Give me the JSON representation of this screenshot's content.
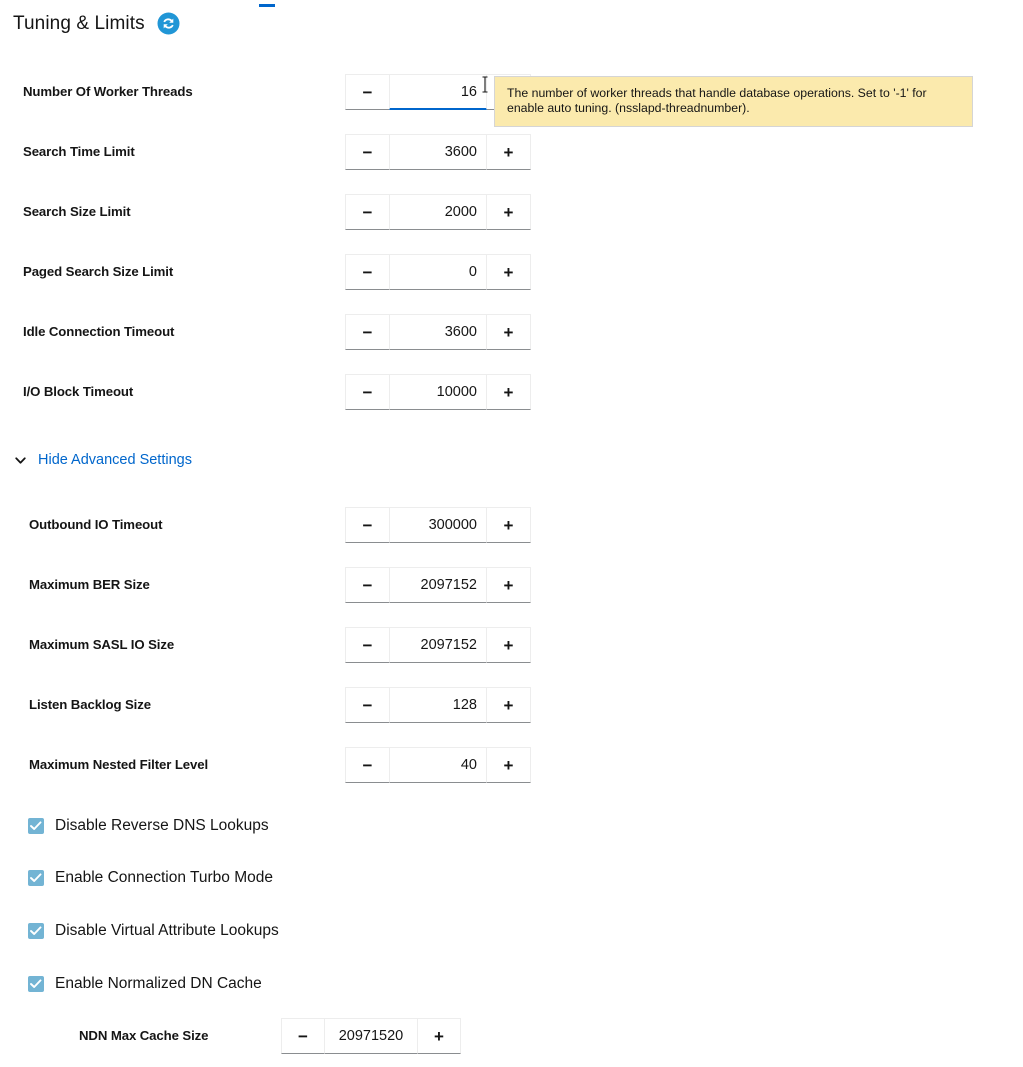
{
  "header": {
    "title": "Tuning & Limits",
    "refresh_icon": "refresh-icon",
    "refresh_color": "#2196d6"
  },
  "colors": {
    "link": "#06c",
    "focus_underline": "#06c",
    "checkbox_fill": "#73b4d4",
    "tooltip_bg": "#fbeaad",
    "tooltip_border": "#d5d5d5"
  },
  "tooltip": {
    "visible": true,
    "text": "The number of worker threads that handle database operations.  Set to '-1' for enable auto tuning. (nsslapd-threadnumber)."
  },
  "basic_fields": [
    {
      "label": "Number Of Worker Threads",
      "value": "16",
      "focused": true,
      "decrement": "−",
      "increment": "+"
    },
    {
      "label": "Search Time Limit",
      "value": "3600",
      "focused": false,
      "decrement": "−",
      "increment": "+"
    },
    {
      "label": "Search Size Limit",
      "value": "2000",
      "focused": false,
      "decrement": "−",
      "increment": "+"
    },
    {
      "label": "Paged Search Size Limit",
      "value": "0",
      "focused": false,
      "decrement": "−",
      "increment": "+"
    },
    {
      "label": "Idle Connection Timeout",
      "value": "3600",
      "focused": false,
      "decrement": "−",
      "increment": "+"
    },
    {
      "label": "I/O Block Timeout",
      "value": "10000",
      "focused": false,
      "decrement": "−",
      "increment": "+"
    }
  ],
  "advanced_toggle": {
    "label": "Hide Advanced Settings",
    "expanded": true,
    "icon": "chevron-down-icon"
  },
  "advanced_fields": [
    {
      "label": "Outbound IO Timeout",
      "value": "300000",
      "decrement": "−",
      "increment": "+"
    },
    {
      "label": "Maximum BER Size",
      "value": "2097152",
      "decrement": "−",
      "increment": "+"
    },
    {
      "label": "Maximum SASL IO Size",
      "value": "2097152",
      "decrement": "−",
      "increment": "+"
    },
    {
      "label": "Listen Backlog Size",
      "value": "128",
      "decrement": "−",
      "increment": "+"
    },
    {
      "label": "Maximum Nested Filter Level",
      "value": "40",
      "decrement": "−",
      "increment": "+"
    }
  ],
  "checkboxes": [
    {
      "label": "Disable Reverse DNS Lookups",
      "checked": true
    },
    {
      "label": "Enable Connection Turbo Mode",
      "checked": true
    },
    {
      "label": "Disable Virtual Attribute Lookups",
      "checked": true
    },
    {
      "label": "Enable Normalized DN Cache",
      "checked": true
    }
  ],
  "ndn_field": {
    "label": "NDN Max Cache Size",
    "value": "20971520",
    "decrement": "−",
    "increment": "+"
  }
}
